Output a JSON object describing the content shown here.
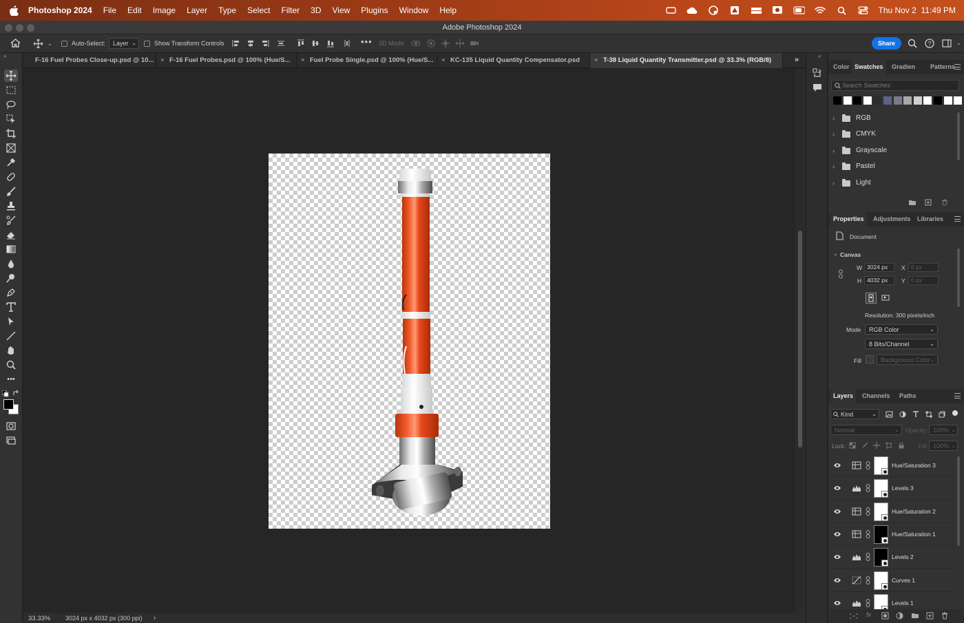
{
  "menubar": {
    "app_name": "Photoshop 2024",
    "items": [
      "File",
      "Edit",
      "Image",
      "Layer",
      "Type",
      "Select",
      "Filter",
      "3D",
      "View",
      "Plugins",
      "Window",
      "Help"
    ],
    "clock": "Thu Nov 2  11:49 PM"
  },
  "window": {
    "title": "Adobe Photoshop 2024"
  },
  "options": {
    "auto_select_label": "Auto-Select:",
    "auto_select_value": "Layer",
    "show_transform_label": "Show Transform Controls",
    "mode_3d_label": "3D Mode:",
    "share_label": "Share"
  },
  "tabs": [
    {
      "label": "F-16 Fuel Probes Close-up.psd @ 10..."
    },
    {
      "label": "F-16 Fuel Probes.psd @ 100% (Hue/S..."
    },
    {
      "label": "Fuel Probe Single.psd @ 100% (Hue/S..."
    },
    {
      "label": "KC-135 Liquid Quantity Compensator.psd"
    },
    {
      "label": "T-38 Liquid Quantity Transmitter.psd @ 33.3% (RGB/8)"
    }
  ],
  "status": {
    "zoom": "33.33%",
    "doc_info": "3024 px x 4032 px (300 ppi)"
  },
  "swatches_panel": {
    "tabs": [
      "Color",
      "Swatches",
      "Gradien",
      "Patterns"
    ],
    "search_placeholder": "Search Swatches",
    "colors": [
      "#000000",
      "#ffffff",
      "#000000",
      "#ffffff",
      "#2c2c2c",
      "#5e6289",
      "#7a7a8a",
      "#a8a8a8",
      "#d0d0d0",
      "#ffffff",
      "#000000",
      "#ffffff",
      "#ffffff"
    ],
    "groups": [
      "RGB",
      "CMYK",
      "Grayscale",
      "Pastel",
      "Light"
    ]
  },
  "properties_panel": {
    "tabs": [
      "Properties",
      "Adjustments",
      "Libraries"
    ],
    "doc_label": "Document",
    "canvas_label": "Canvas",
    "w_label": "W",
    "w_value": "3024 px",
    "h_label": "H",
    "h_value": "4032 px",
    "x_label": "X",
    "x_value": "0 px",
    "y_label": "Y",
    "y_value": "0 px",
    "resolution": "Resolution: 300 pixels/inch",
    "mode_label": "Mode",
    "mode_value": "RGB Color",
    "bits_value": "8 Bits/Channel",
    "fill_label": "Fill",
    "fill_value": "Background Color"
  },
  "layers_panel": {
    "tabs": [
      "Layers",
      "Channels",
      "Paths"
    ],
    "filter_value": "Kind",
    "blend_value": "Normal",
    "opacity_label": "Opacity:",
    "opacity_value": "100%",
    "lock_label": "Lock:",
    "fill_label": "Fill:",
    "fill_value": "100%",
    "layers": [
      {
        "name": "Hue/Saturation 3",
        "type": "hue",
        "mask": "white"
      },
      {
        "name": "Levels 3",
        "type": "levels",
        "mask": "white"
      },
      {
        "name": "Hue/Saturation 2",
        "type": "hue",
        "mask": "white"
      },
      {
        "name": "Hue/Saturation 1",
        "type": "hue",
        "mask": "black"
      },
      {
        "name": "Levels 2",
        "type": "levels",
        "mask": "black"
      },
      {
        "name": "Curves 1",
        "type": "curves",
        "mask": "white"
      },
      {
        "name": "Levels 1",
        "type": "levels",
        "mask": "white"
      }
    ]
  }
}
